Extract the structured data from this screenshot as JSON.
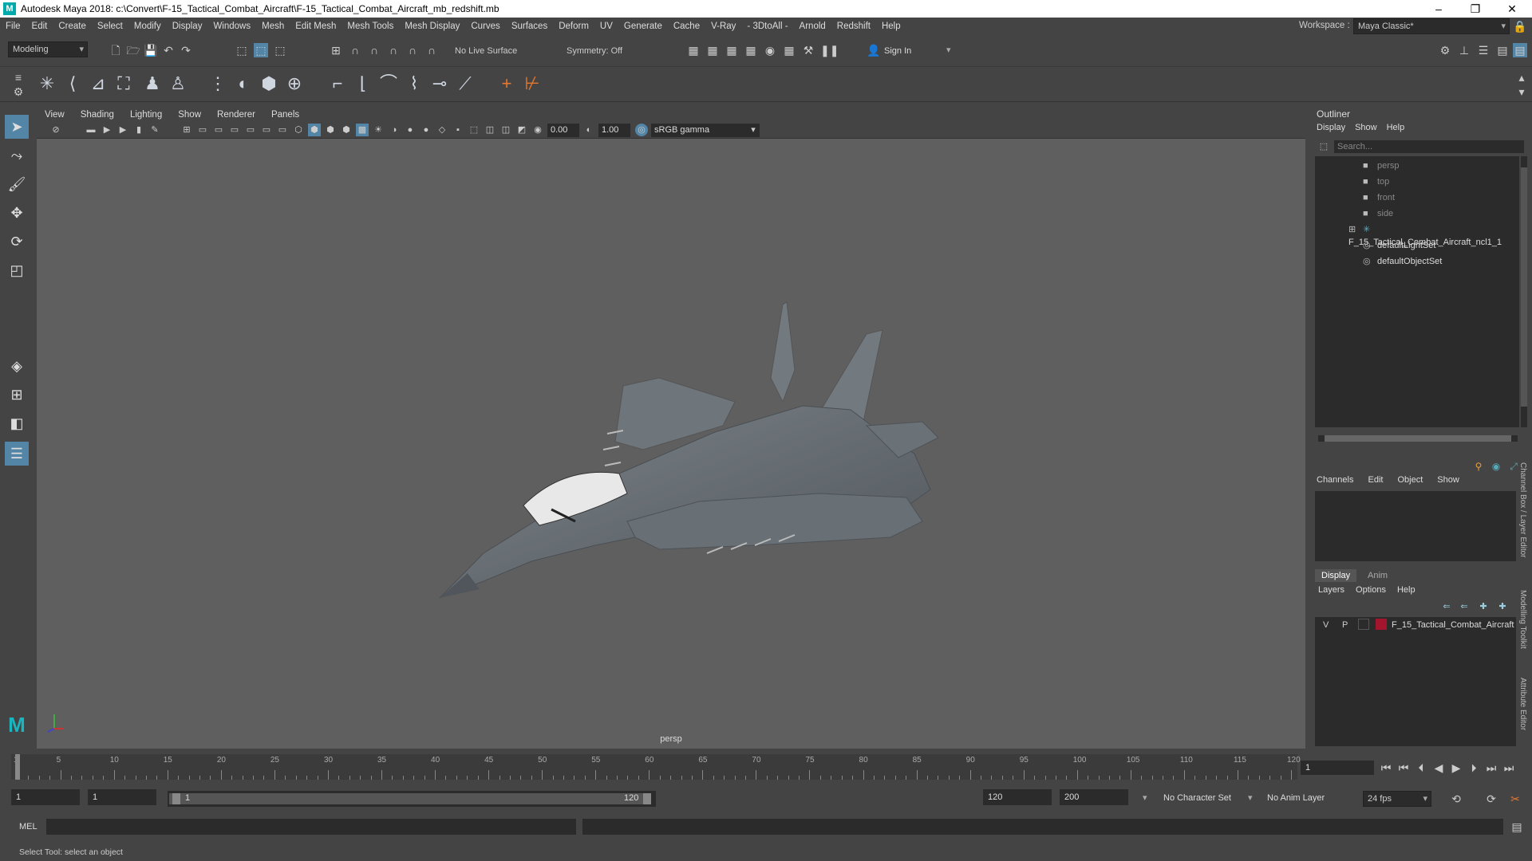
{
  "window": {
    "title": "Autodesk Maya 2018: c:\\Convert\\F-15_Tactical_Combat_Aircraft\\F-15_Tactical_Combat_Aircraft_mb_redshift.mb"
  },
  "menubar": {
    "items": [
      "File",
      "Edit",
      "Create",
      "Select",
      "Modify",
      "Display",
      "Windows",
      "Mesh",
      "Edit Mesh",
      "Mesh Tools",
      "Mesh Display",
      "Curves",
      "Surfaces",
      "Deform",
      "UV",
      "Generate",
      "Cache",
      "V-Ray",
      "- 3DtoAll -",
      "Arnold",
      "Redshift",
      "Help"
    ]
  },
  "workspace": {
    "label": "Workspace :",
    "value": "Maya Classic*"
  },
  "statusline": {
    "mode": "Modeling",
    "live_surface": "No Live Surface",
    "symmetry": "Symmetry: Off",
    "sign_in": "Sign In"
  },
  "viewport": {
    "menus": [
      "View",
      "Shading",
      "Lighting",
      "Show",
      "Renderer",
      "Panels"
    ],
    "exposure": "0.00",
    "gamma": "1.00",
    "color_space": "sRGB gamma",
    "camera_label": "persp"
  },
  "outliner": {
    "title": "Outliner",
    "menus": [
      "Display",
      "Show",
      "Help"
    ],
    "search_placeholder": "Search...",
    "items": [
      "persp",
      "top",
      "front",
      "side",
      "F_15_Tactical_Combat_Aircraft_ncl1_1",
      "defaultLightSet",
      "defaultObjectSet"
    ]
  },
  "channel_box": {
    "menus": [
      "Channels",
      "Edit",
      "Object",
      "Show"
    ]
  },
  "layer_editor": {
    "tabs": [
      "Display",
      "Anim"
    ],
    "menus": [
      "Layers",
      "Options",
      "Help"
    ],
    "layer": {
      "v": "V",
      "p": "P",
      "name": "F_15_Tactical_Combat_Aircraft",
      "color": "#a3152c"
    }
  },
  "side_tabs": [
    "Channel Box / Layer Editor",
    "Modelling Toolkit",
    "Attribute Editor"
  ],
  "timeline": {
    "ticks": [
      "1",
      "5",
      "10",
      "15",
      "20",
      "25",
      "30",
      "35",
      "40",
      "45",
      "50",
      "55",
      "60",
      "65",
      "70",
      "75",
      "80",
      "85",
      "90",
      "95",
      "100",
      "105",
      "110",
      "115",
      "120"
    ],
    "current_frame": "1"
  },
  "range": {
    "start": "1",
    "playback_start": "1",
    "slider_start": "1",
    "slider_end": "120",
    "playback_end": "120",
    "end": "200",
    "character_set": "No Character Set",
    "anim_layer": "No Anim Layer",
    "fps": "24 fps"
  },
  "command": {
    "label": "MEL"
  },
  "help_line": "Select Tool: select an object",
  "colors": {
    "bg": "#444444",
    "viewport": "#5f5f5f",
    "field": "#2b2b2b",
    "accent_blue": "#5285a6",
    "orange": "#e7772e"
  }
}
